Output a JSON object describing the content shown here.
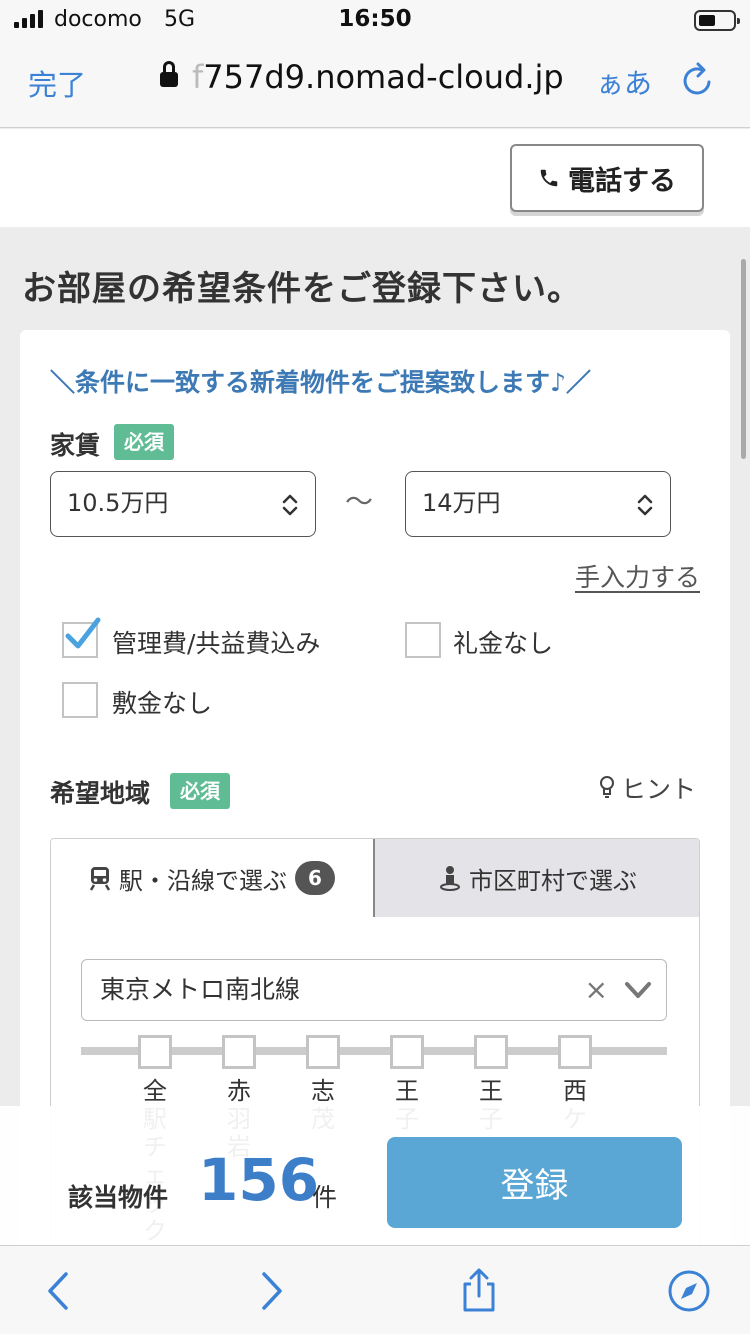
{
  "status_bar": {
    "carrier": "docomo",
    "network": "5G",
    "time": "16:50"
  },
  "browser": {
    "done_label": "完了",
    "url_faded": "f",
    "url": "757d9.nomad-cloud.jp",
    "text_size_label": "ぁあ"
  },
  "header": {
    "call_label": "電話する"
  },
  "page": {
    "title": "お部屋の希望条件をご登録下さい。",
    "tagline": "＼条件に一致する新着物件をご提案致します♪／"
  },
  "rent": {
    "label": "家賃",
    "required_badge": "必須",
    "min": "10.5万円",
    "separator": "〜",
    "max": "14万円",
    "manual_link": "手入力する"
  },
  "options": [
    {
      "label": "管理費/共益費込み",
      "checked": true
    },
    {
      "label": "礼金なし",
      "checked": false
    },
    {
      "label": "敷金なし",
      "checked": false
    }
  ],
  "area": {
    "label": "希望地域",
    "required_badge": "必須",
    "hint_label": "ヒント",
    "tabs": [
      {
        "label": "駅・沿線で選ぶ",
        "count": "6",
        "icon": "train-icon",
        "active": true
      },
      {
        "label": "市区町村で選ぶ",
        "icon": "person-pin-icon",
        "active": false
      }
    ],
    "line_select": {
      "value": "東京メトロ南北線",
      "clear": "×"
    },
    "stations": [
      "全駅チェック",
      "赤羽岩",
      "志茂",
      "王子",
      "王子",
      "西ケ"
    ]
  },
  "result_bar": {
    "label": "該当物件",
    "count": "156",
    "unit": "件",
    "register_label": "登録"
  },
  "colors": {
    "accent": "#3b82d6",
    "required": "#5fbc94",
    "register": "#5aa7d6",
    "count": "#3d7ec8"
  }
}
